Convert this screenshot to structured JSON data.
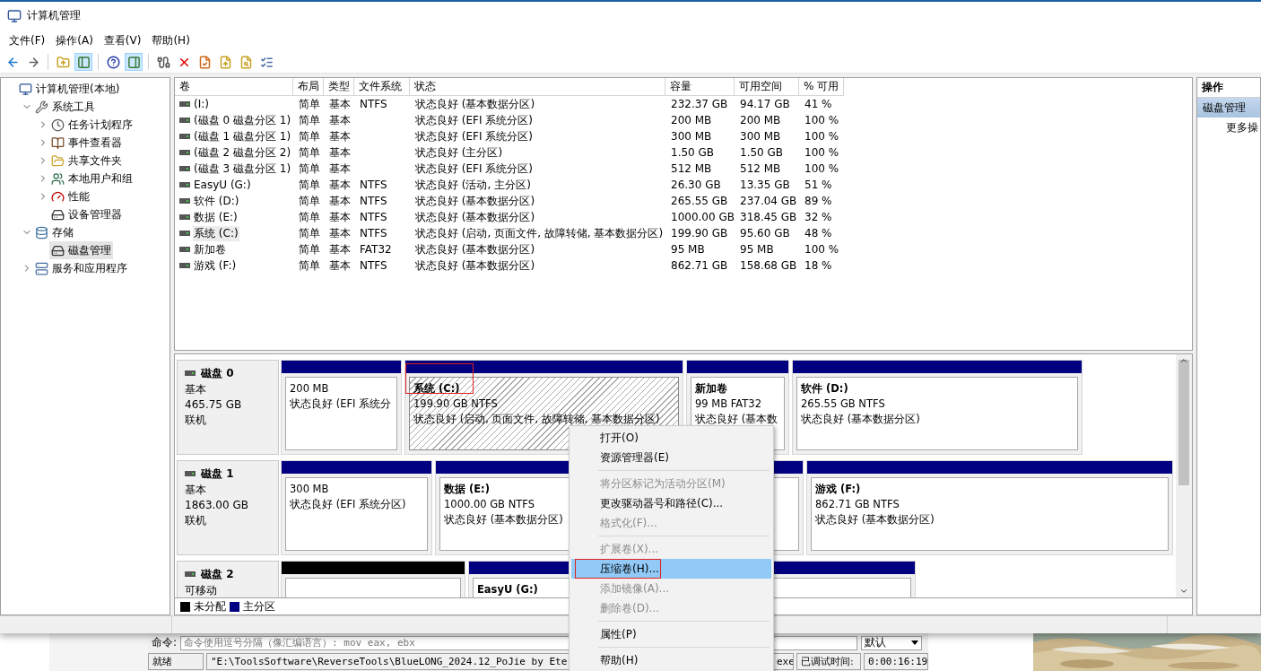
{
  "window": {
    "title": "计算机管理"
  },
  "menu": [
    "文件(F)",
    "操作(A)",
    "查看(V)",
    "帮助(H)"
  ],
  "toolbar": [
    {
      "kind": "back",
      "pressed": false
    },
    {
      "kind": "forward",
      "pressed": false
    },
    {
      "kind": "sep"
    },
    {
      "kind": "up",
      "pressed": false
    },
    {
      "kind": "tree-pane",
      "pressed": true
    },
    {
      "kind": "sep"
    },
    {
      "kind": "help",
      "pressed": false
    },
    {
      "kind": "action-pane",
      "pressed": true
    },
    {
      "kind": "sep"
    },
    {
      "kind": "connect",
      "pressed": false
    },
    {
      "kind": "delete",
      "pressed": false
    },
    {
      "kind": "check",
      "pressed": false
    },
    {
      "kind": "export",
      "pressed": false
    },
    {
      "kind": "find",
      "pressed": false
    },
    {
      "kind": "list",
      "pressed": false
    }
  ],
  "tree": [
    {
      "label": "计算机管理(本地)",
      "kind": "computer",
      "selected": false,
      "children": [
        {
          "label": "系统工具",
          "kind": "tools",
          "selected": false,
          "expanded": true,
          "children": [
            {
              "label": "任务计划程序",
              "kind": "clock",
              "selected": false,
              "expanded": false
            },
            {
              "label": "事件查看器",
              "kind": "log",
              "selected": false,
              "expanded": false
            },
            {
              "label": "共享文件夹",
              "kind": "folder",
              "selected": false,
              "expanded": false
            },
            {
              "label": "本地用户和组",
              "kind": "users",
              "selected": false,
              "expanded": false
            },
            {
              "label": "性能",
              "kind": "gauge",
              "selected": false,
              "expanded": false
            },
            {
              "label": "设备管理器",
              "kind": "device",
              "selected": false
            }
          ]
        },
        {
          "label": "存储",
          "kind": "storage",
          "selected": false,
          "expanded": true,
          "children": [
            {
              "label": "磁盘管理",
              "kind": "disk",
              "selected": true
            }
          ]
        },
        {
          "label": "服务和应用程序",
          "kind": "services",
          "selected": false,
          "expanded": false
        }
      ]
    }
  ],
  "volumes": {
    "columns": [
      "卷",
      "布局",
      "类型",
      "文件系统",
      "状态",
      "容量",
      "可用空间",
      "% 可用"
    ],
    "rows": [
      {
        "selected": false,
        "cells": [
          " (I:)",
          "简单",
          "基本",
          "NTFS",
          "状态良好 (基本数据分区)",
          "232.37 GB",
          "94.17 GB",
          "41 %"
        ]
      },
      {
        "selected": false,
        "cells": [
          "(磁盘 0 磁盘分区 1)",
          "简单",
          "基本",
          "",
          "状态良好 (EFI 系统分区)",
          "200 MB",
          "200 MB",
          "100 %"
        ]
      },
      {
        "selected": false,
        "cells": [
          "(磁盘 1 磁盘分区 1)",
          "简单",
          "基本",
          "",
          "状态良好 (EFI 系统分区)",
          "300 MB",
          "300 MB",
          "100 %"
        ]
      },
      {
        "selected": false,
        "cells": [
          "(磁盘 2 磁盘分区 2)",
          "简单",
          "基本",
          "",
          "状态良好 (主分区)",
          "1.50 GB",
          "1.50 GB",
          "100 %"
        ]
      },
      {
        "selected": false,
        "cells": [
          "(磁盘 3 磁盘分区 1)",
          "简单",
          "基本",
          "",
          "状态良好 (EFI 系统分区)",
          "512 MB",
          "512 MB",
          "100 %"
        ]
      },
      {
        "selected": false,
        "cells": [
          "EasyU (G:)",
          "简单",
          "基本",
          "NTFS",
          "状态良好 (活动, 主分区)",
          "26.30 GB",
          "13.35 GB",
          "51 %"
        ]
      },
      {
        "selected": false,
        "cells": [
          "软件 (D:)",
          "简单",
          "基本",
          "NTFS",
          "状态良好 (基本数据分区)",
          "265.55 GB",
          "237.04 GB",
          "89 %"
        ]
      },
      {
        "selected": false,
        "cells": [
          "数据 (E:)",
          "简单",
          "基本",
          "NTFS",
          "状态良好 (基本数据分区)",
          "1000.00 GB",
          "318.45 GB",
          "32 %"
        ]
      },
      {
        "selected": true,
        "cells": [
          "系统 (C:)",
          "简单",
          "基本",
          "NTFS",
          "状态良好 (启动, 页面文件, 故障转储, 基本数据分区)",
          "199.90 GB",
          "95.60 GB",
          "48 %"
        ]
      },
      {
        "selected": false,
        "cells": [
          "新加卷",
          "简单",
          "基本",
          "FAT32",
          "状态良好 (基本数据分区)",
          "95 MB",
          "95 MB",
          "100 %"
        ]
      },
      {
        "selected": false,
        "cells": [
          "游戏 (F:)",
          "简单",
          "基本",
          "NTFS",
          "状态良好 (基本数据分区)",
          "862.71 GB",
          "158.68 GB",
          "18 %"
        ]
      }
    ]
  },
  "disks": [
    {
      "name": "磁盘 0",
      "type": "基本",
      "size": "465.75 GB",
      "status": "联机",
      "partitions": [
        {
          "kind": "primary",
          "selected": false,
          "size": "200 MB",
          "status": "状态良好 (EFI 系统分"
        },
        {
          "kind": "primary",
          "selected": true,
          "annotated": true,
          "name": "系统  (C:)",
          "size": "199.90 GB NTFS",
          "status": "状态良好 (启动, 页面文件, 故障转储, 基本数据分区)"
        },
        {
          "kind": "primary",
          "selected": false,
          "name": "新加卷",
          "size": "99 MB FAT32",
          "status": "状态良好 (基本数"
        },
        {
          "kind": "primary",
          "selected": false,
          "name": "软件  (D:)",
          "size": "265.55 GB NTFS",
          "status": "状态良好 (基本数据分区)"
        }
      ]
    },
    {
      "name": "磁盘 1",
      "type": "基本",
      "size": "1863.00 GB",
      "status": "联机",
      "partitions": [
        {
          "kind": "primary",
          "selected": false,
          "size": "300 MB",
          "status": "状态良好 (EFI 系统分区)"
        },
        {
          "kind": "primary",
          "selected": false,
          "name": "数据  (E:)",
          "size": "1000.00 GB NTFS",
          "status": "状态良好 (基本数据分区)"
        },
        {
          "kind": "primary",
          "selected": false,
          "name": "游戏  (F:)",
          "size": "862.71 GB NTFS",
          "status": "状态良好 (基本数据分区)"
        }
      ]
    },
    {
      "name": "磁盘 2",
      "type": "可移动",
      "partitions": [
        {
          "kind": "unallocated",
          "selected": false
        },
        {
          "kind": "primary",
          "selected": false,
          "name": "EasyU  (G:)"
        }
      ]
    }
  ],
  "legend": [
    {
      "label": "未分配",
      "color": "#000000"
    },
    {
      "label": "主分区",
      "color": "#000080"
    }
  ],
  "actions": {
    "title": "操作",
    "items": [
      {
        "label": "磁盘管理",
        "kind": "header",
        "selected": true
      },
      {
        "label": "更多操",
        "kind": "item",
        "selected": false
      }
    ]
  },
  "context_menu": [
    {
      "kind": "item",
      "label": "打开(O)",
      "disabled": false,
      "selected": false
    },
    {
      "kind": "item",
      "label": "资源管理器(E)",
      "disabled": false,
      "selected": false
    },
    {
      "kind": "sep"
    },
    {
      "kind": "item",
      "label": "将分区标记为活动分区(M)",
      "disabled": true,
      "selected": false
    },
    {
      "kind": "item",
      "label": "更改驱动器号和路径(C)...",
      "disabled": false,
      "selected": false
    },
    {
      "kind": "item",
      "label": "格式化(F)...",
      "disabled": true,
      "selected": false
    },
    {
      "kind": "sep"
    },
    {
      "kind": "item",
      "label": "扩展卷(X)...",
      "disabled": true,
      "selected": false
    },
    {
      "kind": "item",
      "label": "压缩卷(H)...",
      "disabled": false,
      "selected": true,
      "annotated": true
    },
    {
      "kind": "item",
      "label": "添加镜像(A)...",
      "disabled": true,
      "selected": false
    },
    {
      "kind": "item",
      "label": "删除卷(D)...",
      "disabled": true,
      "selected": false
    },
    {
      "kind": "sep"
    },
    {
      "kind": "item",
      "label": "属性(P)",
      "disabled": false,
      "selected": false
    },
    {
      "kind": "sep"
    },
    {
      "kind": "item",
      "label": "帮助(H)",
      "disabled": false,
      "selected": false
    }
  ],
  "background_window": {
    "command_label": "命令:",
    "command_placeholder": "命令使用逗号分隔（像汇编语言）: mov eax, ebx",
    "mode": "默认",
    "status": "就绪",
    "path": "\"E:\\ToolsSoftware\\ReverseTools\\BlueLONG_2024.12_PoJie  by  Ete",
    "path_tail": "exe",
    "timer_label": "已调试时间:",
    "timer": "0:00:16:19"
  }
}
